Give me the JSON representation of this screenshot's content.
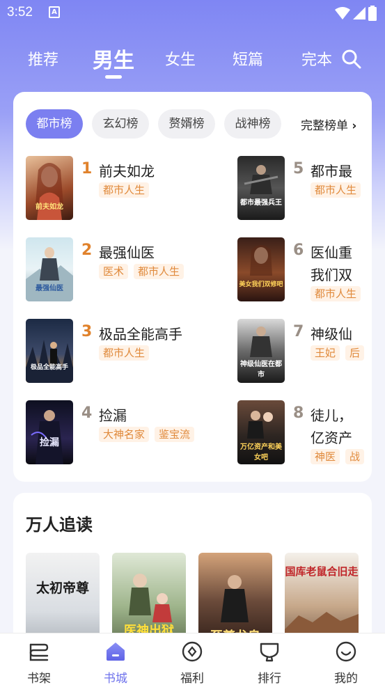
{
  "status_bar": {
    "time": "3:52",
    "notification_glyph": "A"
  },
  "top_tabs": [
    {
      "label": "推荐"
    },
    {
      "label": "男生",
      "active": true
    },
    {
      "label": "女生"
    },
    {
      "label": "短篇"
    },
    {
      "label": "完本"
    }
  ],
  "rank_chips": [
    {
      "label": "都市榜",
      "active": true
    },
    {
      "label": "玄幻榜"
    },
    {
      "label": "赘婿榜"
    },
    {
      "label": "战神榜"
    }
  ],
  "full_list_label": "完整榜单",
  "rank_items": [
    {
      "num": "1",
      "title": "前夫如龙",
      "tags": [
        "都市人生"
      ],
      "cover_text": "前夫如龙"
    },
    {
      "num": "2",
      "title": "最强仙医",
      "tags": [
        "医术",
        "都市人生"
      ],
      "cover_text": "最强仙医"
    },
    {
      "num": "3",
      "title": "极品全能高手",
      "tags": [
        "都市人生"
      ],
      "cover_text": "极品全能高手"
    },
    {
      "num": "4",
      "title": "捡漏",
      "tags": [
        "大神名家",
        "鉴宝流"
      ],
      "cover_text": "捡漏"
    },
    {
      "num": "5",
      "title": "都市最",
      "tags": [
        "都市人生"
      ],
      "cover_text": "都市最强兵王"
    },
    {
      "num": "6",
      "title": "医仙重",
      "title2": "我们双",
      "tags": [
        "都市人生"
      ],
      "cover_text": "美女我们双修吧"
    },
    {
      "num": "7",
      "title": "神级仙",
      "tags": [
        "王妃",
        "后"
      ],
      "cover_text": "神级仙医在都市"
    },
    {
      "num": "8",
      "title": "徒儿，",
      "title2": "亿资产",
      "tags": [
        "神医",
        "战"
      ],
      "cover_text": "万亿资产和美女吧"
    }
  ],
  "section": {
    "title": "万人追读",
    "books": [
      {
        "cover_text": "太初帝尊"
      },
      {
        "cover_text": "医神出狱"
      },
      {
        "cover_text": "至尊龙皇"
      },
      {
        "cover_text": "国库老鼠合旧走"
      }
    ]
  },
  "bottom_nav": [
    {
      "label": "书架",
      "icon": "bookshelf-icon"
    },
    {
      "label": "书城",
      "icon": "home-icon",
      "active": true
    },
    {
      "label": "福利",
      "icon": "welfare-icon"
    },
    {
      "label": "排行",
      "icon": "trophy-icon"
    },
    {
      "label": "我的",
      "icon": "smile-icon"
    }
  ],
  "colors": {
    "accent": "#7b7ff0",
    "rank_top": "#e0822c",
    "rank_other": "#9a8f86",
    "tag_text": "#e08a3c",
    "tag_bg": "#fff2e6"
  }
}
